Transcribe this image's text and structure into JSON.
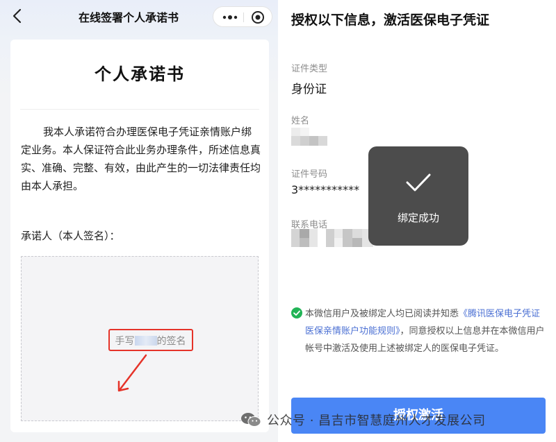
{
  "left": {
    "topbar": {
      "back_icon": "chevron-left-icon",
      "title": "在线签署个人承诺书",
      "more_icon": "more-dots-icon",
      "close_icon": "mini-program-close-icon"
    },
    "doc": {
      "title": "个人承诺书",
      "body": "我本人承诺符合办理医保电子凭证亲情账户绑定业务。本人保证符合此业务办理条件，所述信息真实、准确、完整、有效，由此产生的一切法律责任均由本人承担。",
      "signer_label": "承诺人（本人签名）：",
      "sign_hint_prefix": "手写",
      "sign_hint_suffix": "的签名"
    },
    "colors": {
      "annotation": "#e53329"
    }
  },
  "right": {
    "title": "授权以下信息，激活医保电子凭证",
    "fields": {
      "id_type": {
        "label": "证件类型",
        "value": "身份证"
      },
      "name": {
        "label": "姓名"
      },
      "id_number": {
        "label": "证件号码",
        "value": "3***********"
      },
      "phone": {
        "label": "联系电话"
      }
    },
    "toast": {
      "icon": "checkmark-icon",
      "text": "绑定成功"
    },
    "agreement": {
      "icon": "check-circle-icon",
      "text_prefix": "本微信用户及被绑定人均已阅读并知悉",
      "link": "《腾讯医保电子凭证医保亲情账户功能规则》",
      "text_suffix": "，同意授权以上信息并在本微信用户帐号中激活及使用上述被绑定人的医保电子凭证。"
    },
    "button_label": "授权激活",
    "colors": {
      "primary": "#4a86f5",
      "link": "#4a6fd3",
      "check": "#21b456"
    }
  },
  "watermark": {
    "icon": "wechat-icon",
    "text": "公众号 · 昌吉市智慧庭州人才发展公司"
  }
}
